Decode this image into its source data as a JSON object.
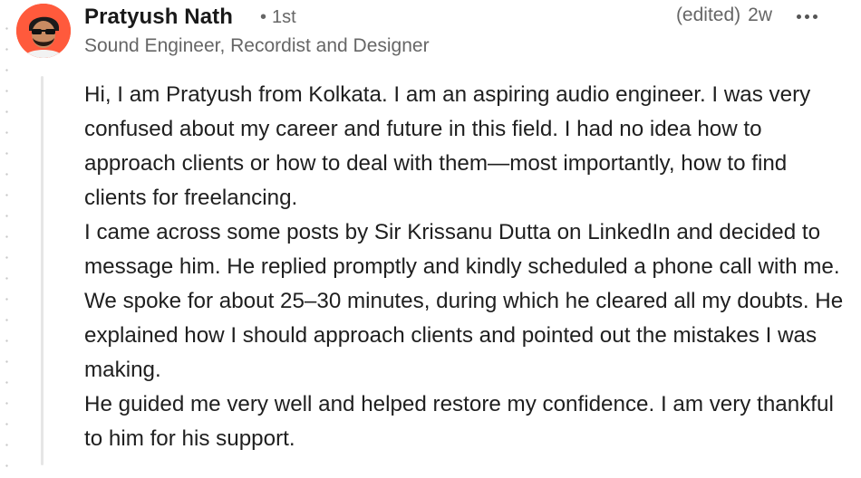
{
  "comment": {
    "author": {
      "name": "Pratyush Nath",
      "degree": "1st",
      "degree_separator": "•",
      "headline": "Sound Engineer, Recordist and Designer",
      "avatar_icon": "profile-photo"
    },
    "meta": {
      "edited_label": "(edited)",
      "time_ago": "2w"
    },
    "more_icon": "more-horizontal-icon",
    "body_paragraphs": [
      "Hi, I am Pratyush from Kolkata. I am an aspiring audio engineer. I was very confused about my career and future in this field. I had no idea how to approach clients or how to deal with them—most importantly, how to find clients for freelancing.",
      "I came across some posts by Sir Krissanu Dutta on LinkedIn and decided to message him. He replied promptly and kindly scheduled a phone call with me. We spoke for about 25–30 minutes, during which he cleared all my doubts. He explained how I should approach clients and pointed out the mistakes I was making.",
      "He guided me very well and helped restore my confidence. I am very thankful to him for his support."
    ],
    "colors": {
      "avatar_background": "#ff5a3c",
      "secondary_text": "#666666",
      "primary_text": "#191919"
    }
  }
}
